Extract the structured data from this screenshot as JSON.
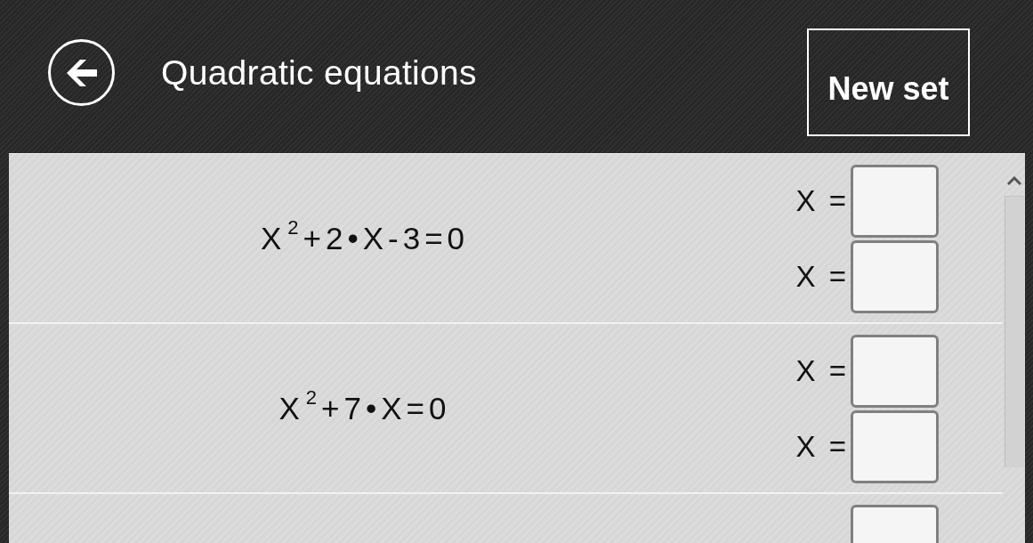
{
  "header": {
    "title": "Quadratic equations",
    "action_button": "New set"
  },
  "problems": [
    {
      "equation": "X$^{2}$+2•X-3=0",
      "answers": [
        {
          "kind": "labeled",
          "label": "X ="
        },
        {
          "kind": "labeled",
          "label": "X ="
        }
      ]
    },
    {
      "equation": "X$^{2}$+7•X=0",
      "answers": [
        {
          "kind": "labeled",
          "label": "X ="
        },
        {
          "kind": "labeled",
          "label": "X ="
        }
      ]
    },
    {
      "answers": [
        {
          "kind": "blank"
        }
      ]
    }
  ]
}
